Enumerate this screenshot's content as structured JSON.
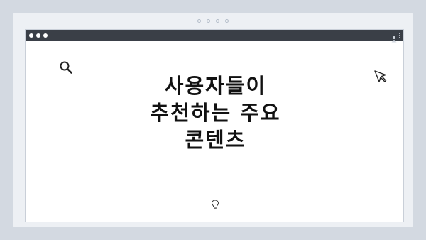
{
  "headline": {
    "line1": "사용자들이",
    "line2": "추천하는 주요",
    "line3": "콘텐츠"
  },
  "icons": {
    "search": "search-icon",
    "cursor": "cursor-icon",
    "bulb": "lightbulb-icon",
    "user": "user-icon",
    "menu": "kebab-menu-icon"
  },
  "colors": {
    "background": "#d3d9e1",
    "titlebar": "#3a3f47",
    "text": "#111111"
  }
}
